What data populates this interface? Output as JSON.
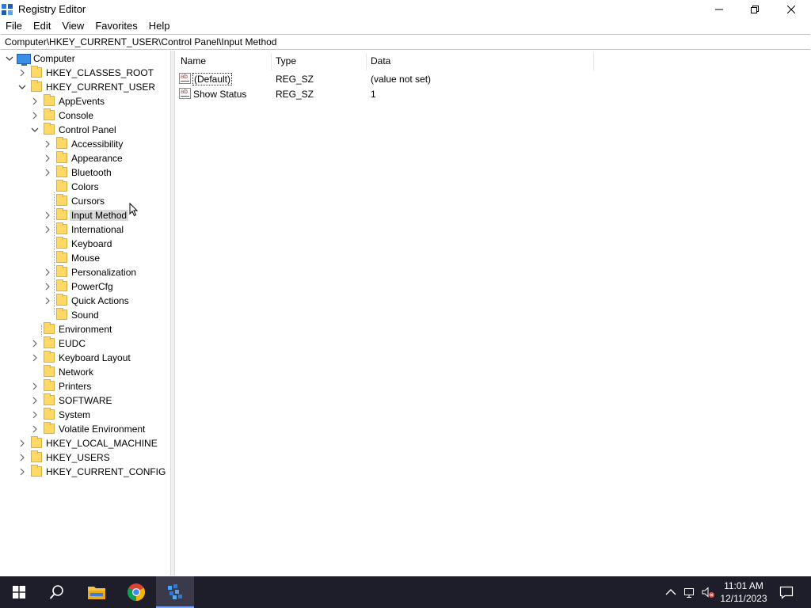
{
  "window": {
    "title": "Registry Editor"
  },
  "menu": [
    "File",
    "Edit",
    "View",
    "Favorites",
    "Help"
  ],
  "address": "Computer\\HKEY_CURRENT_USER\\Control Panel\\Input Method",
  "tree": [
    {
      "label": "Computer"
    },
    {
      "label": "HKEY_CLASSES_ROOT"
    },
    {
      "label": "HKEY_CURRENT_USER"
    },
    {
      "label": "AppEvents"
    },
    {
      "label": "Console"
    },
    {
      "label": "Control Panel"
    },
    {
      "label": "Accessibility"
    },
    {
      "label": "Appearance"
    },
    {
      "label": "Bluetooth"
    },
    {
      "label": "Colors"
    },
    {
      "label": "Cursors"
    },
    {
      "label": "Input Method"
    },
    {
      "label": "International"
    },
    {
      "label": "Keyboard"
    },
    {
      "label": "Mouse"
    },
    {
      "label": "Personalization"
    },
    {
      "label": "PowerCfg"
    },
    {
      "label": "Quick Actions"
    },
    {
      "label": "Sound"
    },
    {
      "label": "Environment"
    },
    {
      "label": "EUDC"
    },
    {
      "label": "Keyboard Layout"
    },
    {
      "label": "Network"
    },
    {
      "label": "Printers"
    },
    {
      "label": "SOFTWARE"
    },
    {
      "label": "System"
    },
    {
      "label": "Volatile Environment"
    },
    {
      "label": "HKEY_LOCAL_MACHINE"
    },
    {
      "label": "HKEY_USERS"
    },
    {
      "label": "HKEY_CURRENT_CONFIG"
    }
  ],
  "list": {
    "columns": [
      "Name",
      "Type",
      "Data"
    ],
    "rows": [
      {
        "name": "(Default)",
        "type": "REG_SZ",
        "data": "(value not set)"
      },
      {
        "name": "Show Status",
        "type": "REG_SZ",
        "data": "1"
      }
    ]
  },
  "taskbar": {
    "time": "11:01 AM",
    "date": "12/11/2023",
    "icons": [
      "windows-start-icon",
      "search-icon",
      "file-explorer-icon",
      "chrome-icon",
      "registry-editor-icon"
    ]
  },
  "colors": {
    "taskbar": "#1e1e2a",
    "selected": "#d9d9d9",
    "folder": "#ffd865"
  }
}
